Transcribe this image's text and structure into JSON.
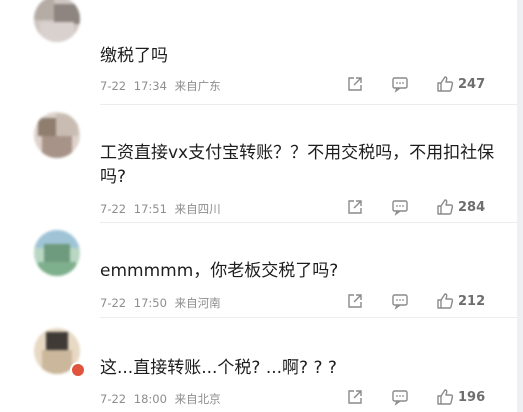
{
  "comments": [
    {
      "username": "",
      "text": "缴税了吗",
      "date": "7-22",
      "time": "17:34",
      "location": "来自广东",
      "likes": "247"
    },
    {
      "username": "",
      "text": "工资直接vx支付宝转账？？不用交税吗，不用扣社保吗?",
      "date": "7-22",
      "time": "17:51",
      "location": "来自四川",
      "likes": "284"
    },
    {
      "username": "",
      "text": "emmmmm，你老板交税了吗?",
      "date": "7-22",
      "time": "17:50",
      "location": "来自河南",
      "likes": "212"
    },
    {
      "username": "",
      "text": "这...直接转账...个税? ...啊? ? ?",
      "date": "7-22",
      "time": "18:00",
      "location": "来自北京",
      "likes": "196"
    }
  ],
  "icons": {
    "share": "share-icon",
    "reply": "comment-icon",
    "like": "thumbs-up-icon"
  }
}
